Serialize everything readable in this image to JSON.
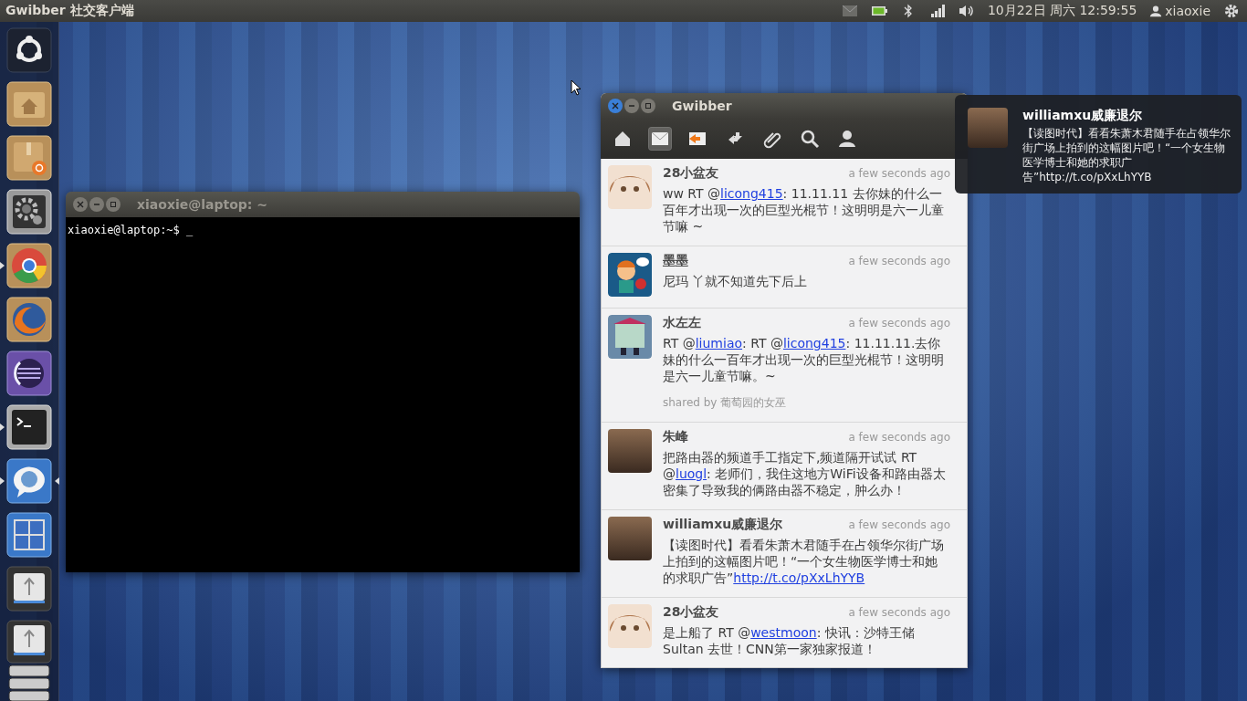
{
  "top_panel": {
    "app_title": "Gwibber 社交客户端",
    "clock": "10月22日 周六 12:59:55",
    "user": "xiaoxie"
  },
  "launcher": [
    {
      "kind": "dash",
      "running": false,
      "focused": false
    },
    {
      "kind": "home",
      "running": false,
      "focused": false
    },
    {
      "kind": "software",
      "running": false,
      "focused": false
    },
    {
      "kind": "settings",
      "running": false,
      "focused": false
    },
    {
      "kind": "chrome",
      "running": true,
      "focused": false
    },
    {
      "kind": "firefox",
      "running": false,
      "focused": false
    },
    {
      "kind": "eclipse",
      "running": false,
      "focused": false
    },
    {
      "kind": "terminal",
      "running": true,
      "focused": false
    },
    {
      "kind": "gwibber",
      "running": true,
      "focused": true
    },
    {
      "kind": "workspaces",
      "running": false,
      "focused": false
    },
    {
      "kind": "usb",
      "running": false,
      "focused": false
    },
    {
      "kind": "usb-stack",
      "running": false,
      "focused": false
    }
  ],
  "terminal": {
    "title": "xiaoxie@laptop: ~",
    "focused": false,
    "prompt": "xiaoxie@laptop:~$ _"
  },
  "gwibber": {
    "title": "Gwibber",
    "focused": true,
    "toolbar": [
      {
        "kind": "home",
        "selected": false
      },
      {
        "kind": "messages",
        "selected": true
      },
      {
        "kind": "replies",
        "selected": false
      },
      {
        "kind": "private",
        "selected": false
      },
      {
        "kind": "attachments",
        "selected": false
      },
      {
        "kind": "search",
        "selected": false
      },
      {
        "kind": "people",
        "selected": false
      }
    ],
    "tweets": [
      {
        "author": "28小盆友",
        "time": "a few seconds ago",
        "kind": "anime",
        "body": [
          {
            "kind": "text",
            "text": "ww RT @"
          },
          {
            "kind": "link",
            "text": "licong415"
          },
          {
            "kind": "text",
            "text": ": 11.11.11 去你妹的什么一百年才出现一次的巨型光棍节！这明明是六一儿童节嘛 ~"
          }
        ]
      },
      {
        "author": "墨墨",
        "time": "a few seconds ago",
        "kind": "cartoon",
        "body": [
          {
            "kind": "text",
            "text": "尼玛 丫就不知道先下后上"
          }
        ]
      },
      {
        "author": "水左左",
        "time": "a few seconds ago",
        "kind": "robot",
        "body": [
          {
            "kind": "text",
            "text": "RT @"
          },
          {
            "kind": "link",
            "text": "liumiao"
          },
          {
            "kind": "text",
            "text": ": RT @"
          },
          {
            "kind": "link",
            "text": "licong415"
          },
          {
            "kind": "text",
            "text": ": 11.11.11.去你妹的什么一百年才出现一次的巨型光棍节！这明明是六一儿童节嘛。~"
          }
        ],
        "shared_by": "shared by 葡萄园的女巫"
      },
      {
        "author": "朱峰",
        "time": "a few seconds ago",
        "kind": "photo",
        "body": [
          {
            "kind": "text",
            "text": "把路由器的频道手工指定下,频道隔开试试 RT @"
          },
          {
            "kind": "link",
            "text": "luogl"
          },
          {
            "kind": "text",
            "text": ": 老师们，我住这地方WiFi设备和路由器太密集了导致我的俩路由器不稳定，肿么办！"
          }
        ]
      },
      {
        "author": "williamxu威廉退尔",
        "time": "a few seconds ago",
        "kind": "photo",
        "body": [
          {
            "kind": "text",
            "text": "【读图时代】看看朱萧木君随手在占领华尔街广场上拍到的这幅图片吧！“一个女生物医学博士和她的求职广告”"
          },
          {
            "kind": "link",
            "text": "http://t.co/pXxLhYYB"
          }
        ]
      },
      {
        "author": "28小盆友",
        "time": "a few seconds ago",
        "kind": "anime",
        "body": [
          {
            "kind": "text",
            "text": "是上船了 RT @"
          },
          {
            "kind": "link",
            "text": "westmoon"
          },
          {
            "kind": "text",
            "text": ": 快讯：沙特王储 Sultan 去世！CNN第一家独家报道！"
          }
        ]
      }
    ]
  },
  "notification": {
    "title": "williamxu威廉退尔",
    "body": "【读图时代】看看朱萧木君随手在占领华尔街广场上拍到的这幅图片吧！“一个女生物医学博士和她的求职广告”http://t.co/pXxLhYYB"
  }
}
